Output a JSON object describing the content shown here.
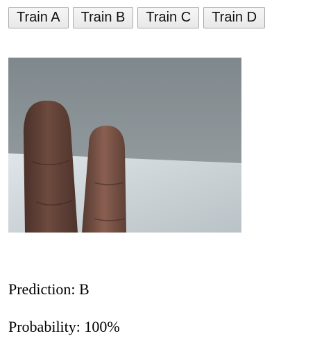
{
  "buttons": [
    {
      "label": "Train A"
    },
    {
      "label": "Train B"
    },
    {
      "label": "Train C"
    },
    {
      "label": "Train D"
    }
  ],
  "webcam": {
    "content": "two fingers raised"
  },
  "result": {
    "prediction_label": "Prediction:",
    "prediction_value": "B",
    "probability_label": "Probability:",
    "probability_value": "100%"
  }
}
